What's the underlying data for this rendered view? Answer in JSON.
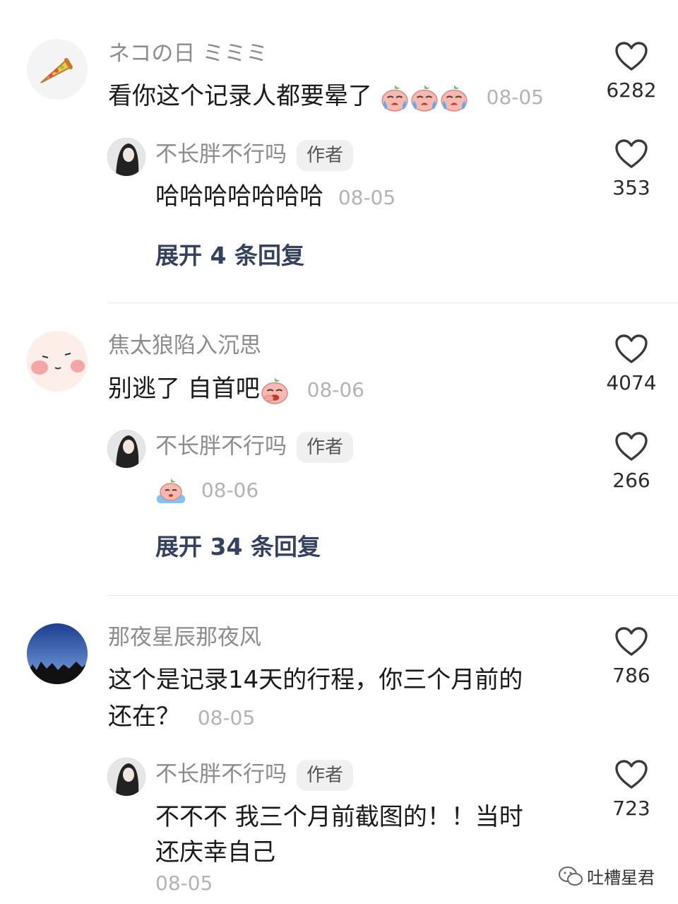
{
  "threads": [
    {
      "user": "ネコの日 ミミミ",
      "text": "看你这个记录人都要晕了",
      "date": "08-05",
      "likes": "6282",
      "reply": {
        "user": "不长胖不行吗",
        "badge": "作者",
        "text": "哈哈哈哈哈哈哈",
        "date": "08-05",
        "likes": "353"
      },
      "expand": "展开 4 条回复"
    },
    {
      "user": "焦太狼陷入沉思",
      "text": "别逃了 自首吧",
      "date": "08-06",
      "likes": "4074",
      "reply": {
        "user": "不长胖不行吗",
        "badge": "作者",
        "text": "",
        "date": "08-06",
        "likes": "266"
      },
      "expand": "展开 34 条回复"
    },
    {
      "user": "那夜星辰那夜风",
      "text_line1": "这个是记录14天的行程，你三个月前的",
      "text_line2": "还在？",
      "date": "08-05",
      "likes": "786",
      "reply": {
        "user": "不长胖不行吗",
        "badge": "作者",
        "text_line1": "不不不 我三个月前截图的！！当时",
        "text_line2": "还庆幸自己",
        "date": "08-05",
        "likes": "723"
      }
    }
  ],
  "watermark": "吐槽星君",
  "colors": {
    "username": "#8c8c8c",
    "expand": "#34425f",
    "date": "#b3b3b3"
  },
  "icons": [
    "heart-outline-icon",
    "crying-bun-emoji",
    "laughing-bun-emoji",
    "sweating-bun-emoji",
    "wechat-icon"
  ]
}
